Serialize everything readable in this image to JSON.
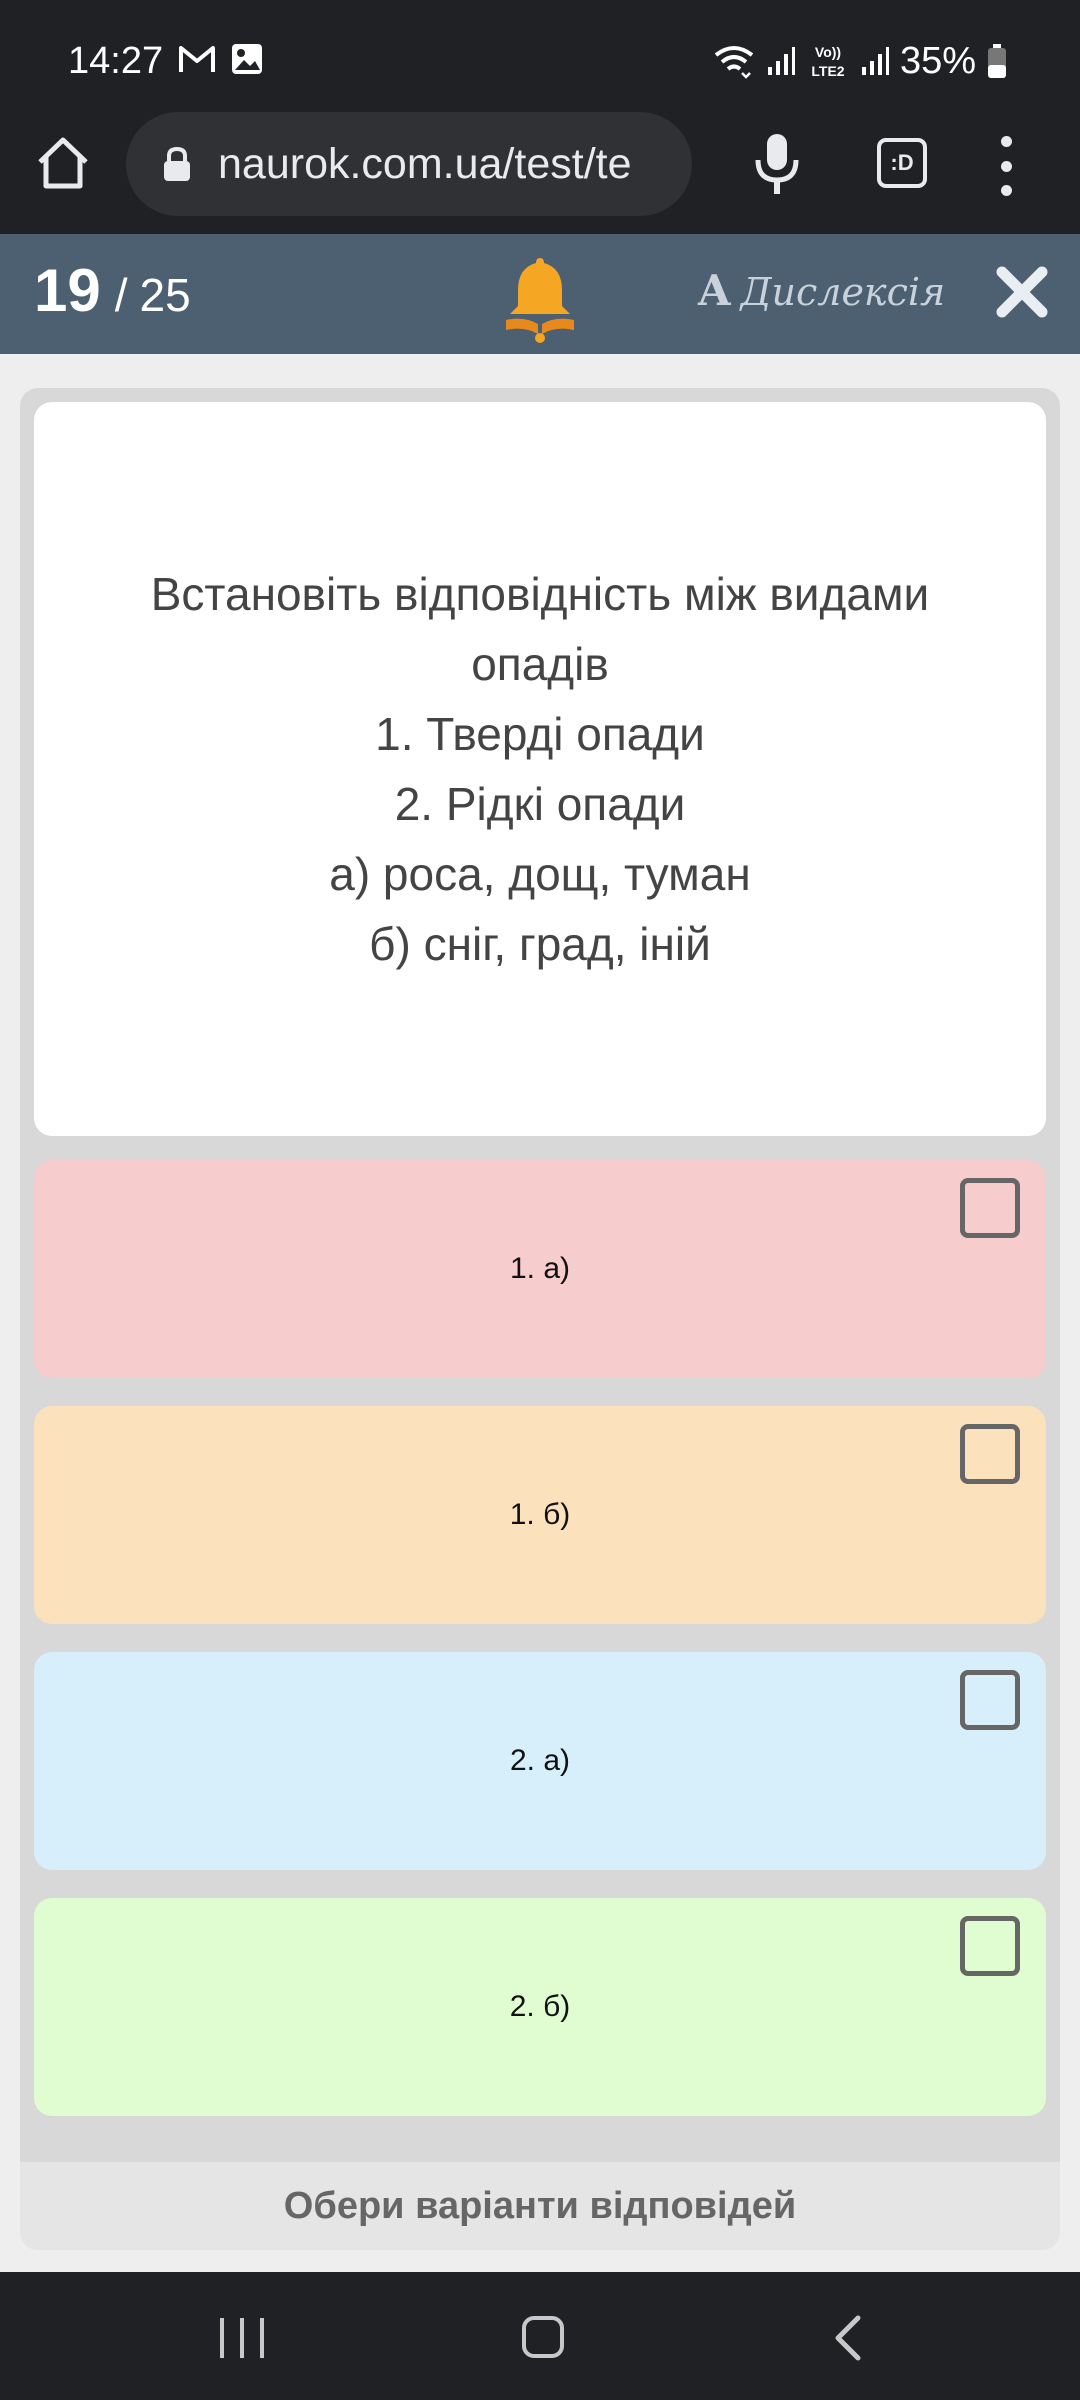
{
  "status_bar": {
    "time": "14:27",
    "battery": "35%",
    "left_icons": [
      "gmail-icon",
      "image-icon"
    ],
    "right_icons": [
      "wifi-icon",
      "signal-icon",
      "volte-icon",
      "signal-icon",
      "battery-icon"
    ],
    "volte_text": "Vo)) LTE2"
  },
  "browser": {
    "url": "naurok.com.ua/test/te",
    "tabs_label": ":D"
  },
  "quiz_header": {
    "current": "19",
    "separator": "/",
    "total": "25",
    "dyslexia_glyph": "A",
    "dyslexia_label": "Дислексія",
    "bell_color": "#f5a623"
  },
  "question": {
    "lines": [
      "Встановіть відповідність між видами",
      "опадів",
      "1. Тверді опади",
      "2. Рідкі опади",
      "а) роса, дощ, туман",
      "б) сніг, град, іній"
    ]
  },
  "options": [
    {
      "label": "1. а)",
      "color": "#f6cccd",
      "checked": false
    },
    {
      "label": "1. б)",
      "color": "#fbe2bc",
      "checked": false
    },
    {
      "label": "2. а)",
      "color": "#d6effa",
      "checked": false
    },
    {
      "label": "2. б)",
      "color": "#e0fdd1",
      "checked": false
    }
  ],
  "hint": "Обери варіанти відповідей"
}
